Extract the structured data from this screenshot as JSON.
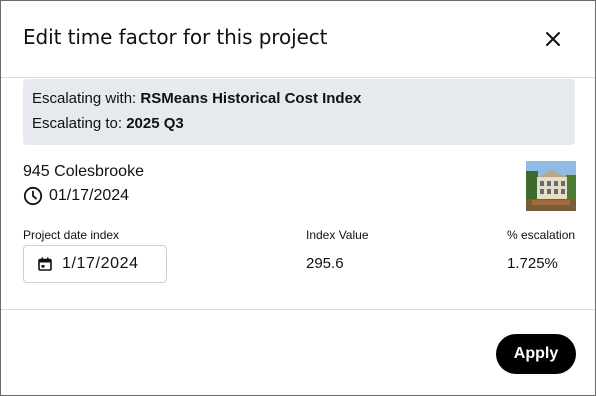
{
  "dialog": {
    "title": "Edit time factor for this project",
    "close_icon": "close-icon"
  },
  "escalation": {
    "with_label": "Escalating with: ",
    "with_value": "RSMeans Historical Cost Index",
    "to_label": "Escalating to: ",
    "to_value": "2025 Q3"
  },
  "project": {
    "name": "945 Colesbrooke",
    "date": "01/17/2024",
    "date_icon": "clock-icon",
    "thumbnail": "project-building-thumbnail"
  },
  "fields": {
    "date_index_label": "Project date index",
    "date_index_value": "1/17/2024",
    "date_icon": "calendar-icon",
    "index_value_label": "Index Value",
    "index_value": "295.6",
    "escalation_label": "% escalation",
    "escalation_value": "1.725%"
  },
  "footer": {
    "apply_label": "Apply"
  },
  "colors": {
    "info_box_bg": "#e6e9ee",
    "primary_button": "#000000",
    "divider": "#dcdcdc"
  }
}
